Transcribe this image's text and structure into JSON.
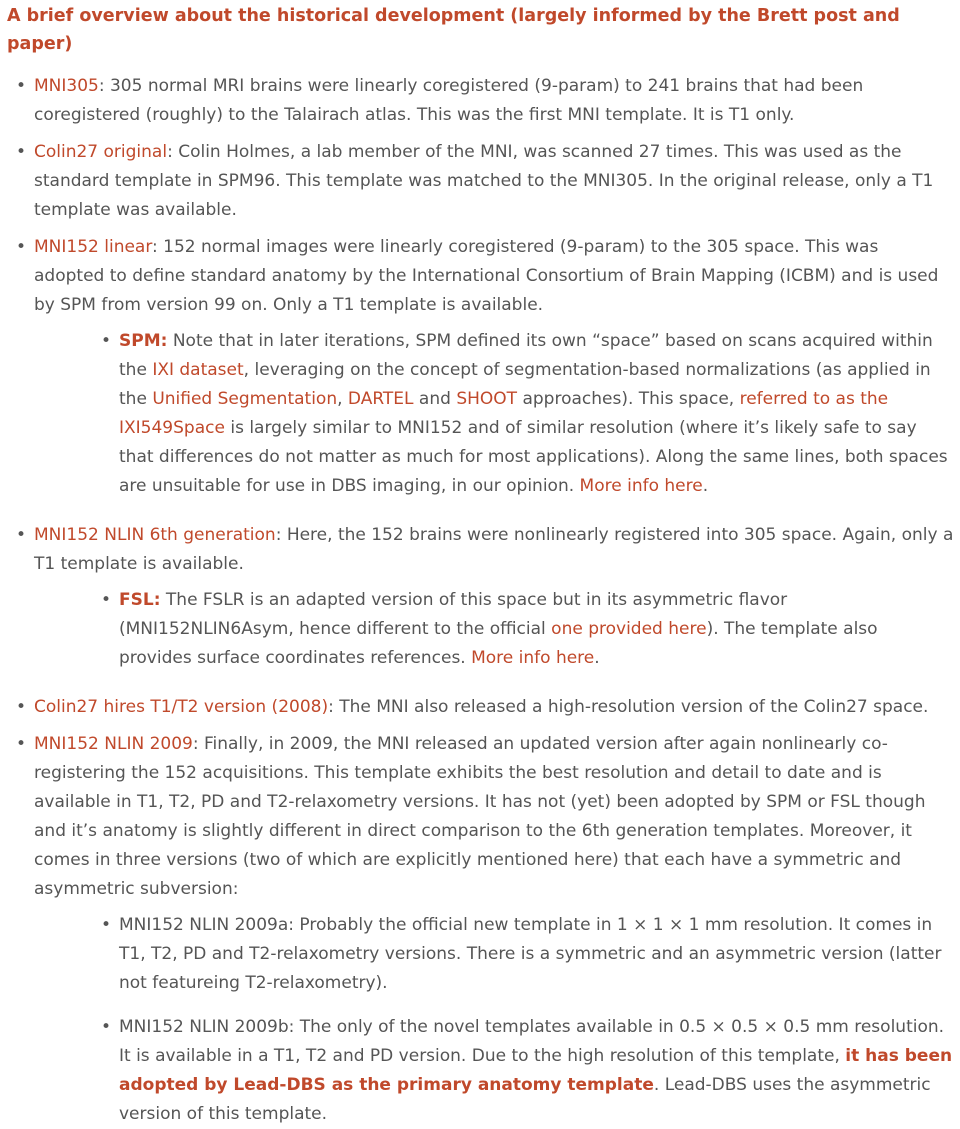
{
  "heading": "A brief overview about the historical development (largely informed by the Brett post and paper)",
  "items": [
    {
      "link": "MNI305",
      "text": ": 305 normal MRI brains were linearly coregistered (9-param) to 241 brains that had been coregistered (roughly) to the Talairach atlas. This was the first MNI template. It is T1 only."
    },
    {
      "link": "Colin27 original",
      "text": ": Colin Holmes, a lab member of the MNI, was scanned 27 times. This was used as the standard template in SPM96. This template was matched to the MNI305. In the original release, only a T1 template was available."
    },
    {
      "link": "MNI152 linear",
      "text": ": 152 normal images were linearly coregistered (9-param) to the 305 space. This was adopted to define standard anatomy by the International Consortium of Brain Mapping (ICBM) and is used by SPM from version 99 on. Only a T1 template is available.",
      "sub": {
        "label": "SPM:",
        "t1": " Note that in later iterations, SPM defined its own “space” based on scans acquired within the ",
        "l1": "IXI dataset",
        "t2": ", leveraging on the concept of segmentation-based normalizations (as applied in the ",
        "l2": "Unified Segmentation",
        "t3": ", ",
        "l3": "DARTEL",
        "t4": " and ",
        "l4": "SHOOT",
        "t5": " approaches). This space, ",
        "l5": "referred to as the IXI549Space",
        "t6": " is largely similar to MNI152 and of similar resolution (where it’s likely safe to say that differences do not matter as much for most applications). Along the same lines, both spaces are unsuitable for use in DBS imaging, in our opinion. ",
        "l6": "More info here",
        "t7": "."
      }
    },
    {
      "link": "MNI152 NLIN 6th generation",
      "text": ": Here, the 152 brains were nonlinearly registered into 305 space. Again, only a T1 template is available.",
      "sub": {
        "label": "FSL:",
        "t1": " The FSLR is an adapted version of this space but in its asymmetric flavor (MNI152NLIN6Asym, hence different to the official ",
        "l1": "one provided here",
        "t2": "). The template also provides surface coordinates references. ",
        "l2": "More info here",
        "t3": "."
      }
    },
    {
      "link": "Colin27 hires T1/T2 version (2008)",
      "text": ": The MNI also released a high-resolution version of the Colin27 space."
    },
    {
      "link": "MNI152 NLIN 2009",
      "text": ": Finally, in 2009, the MNI released an updated version after again nonlinearly co-registering the 152 acquisitions. This template exhibits the best resolution and detail to date and is available in T1, T2, PD and T2-relaxometry versions. It has not (yet) been adopted by SPM or FSL though and it’s anatomy is slightly different in direct comparison to the 6th generation templates. Moreover, it comes in three versions (two of which are explicitly mentioned here) that each have a symmetric and asymmetric subversion:",
      "subs": [
        {
          "text": "MNI152 NLIN 2009a: Probably the official new template in 1 × 1 × 1 mm resolution. It comes in T1, T2, PD and T2-relaxometry versions. There is a symmetric and an asymmetric version (latter not featureing T2-relaxometry)."
        },
        {
          "t1": "MNI152 NLIN 2009b: The only of the novel templates available in 0.5 × 0.5 × 0.5 mm resolution. It is available in a T1, T2 and PD version. Due to the high resolution of this template, ",
          "bold": "it has been adopted by Lead-DBS as the primary anatomy template",
          "t2": ". Lead-DBS uses the asymmetric version of this template."
        }
      ]
    }
  ],
  "bullet": "•"
}
